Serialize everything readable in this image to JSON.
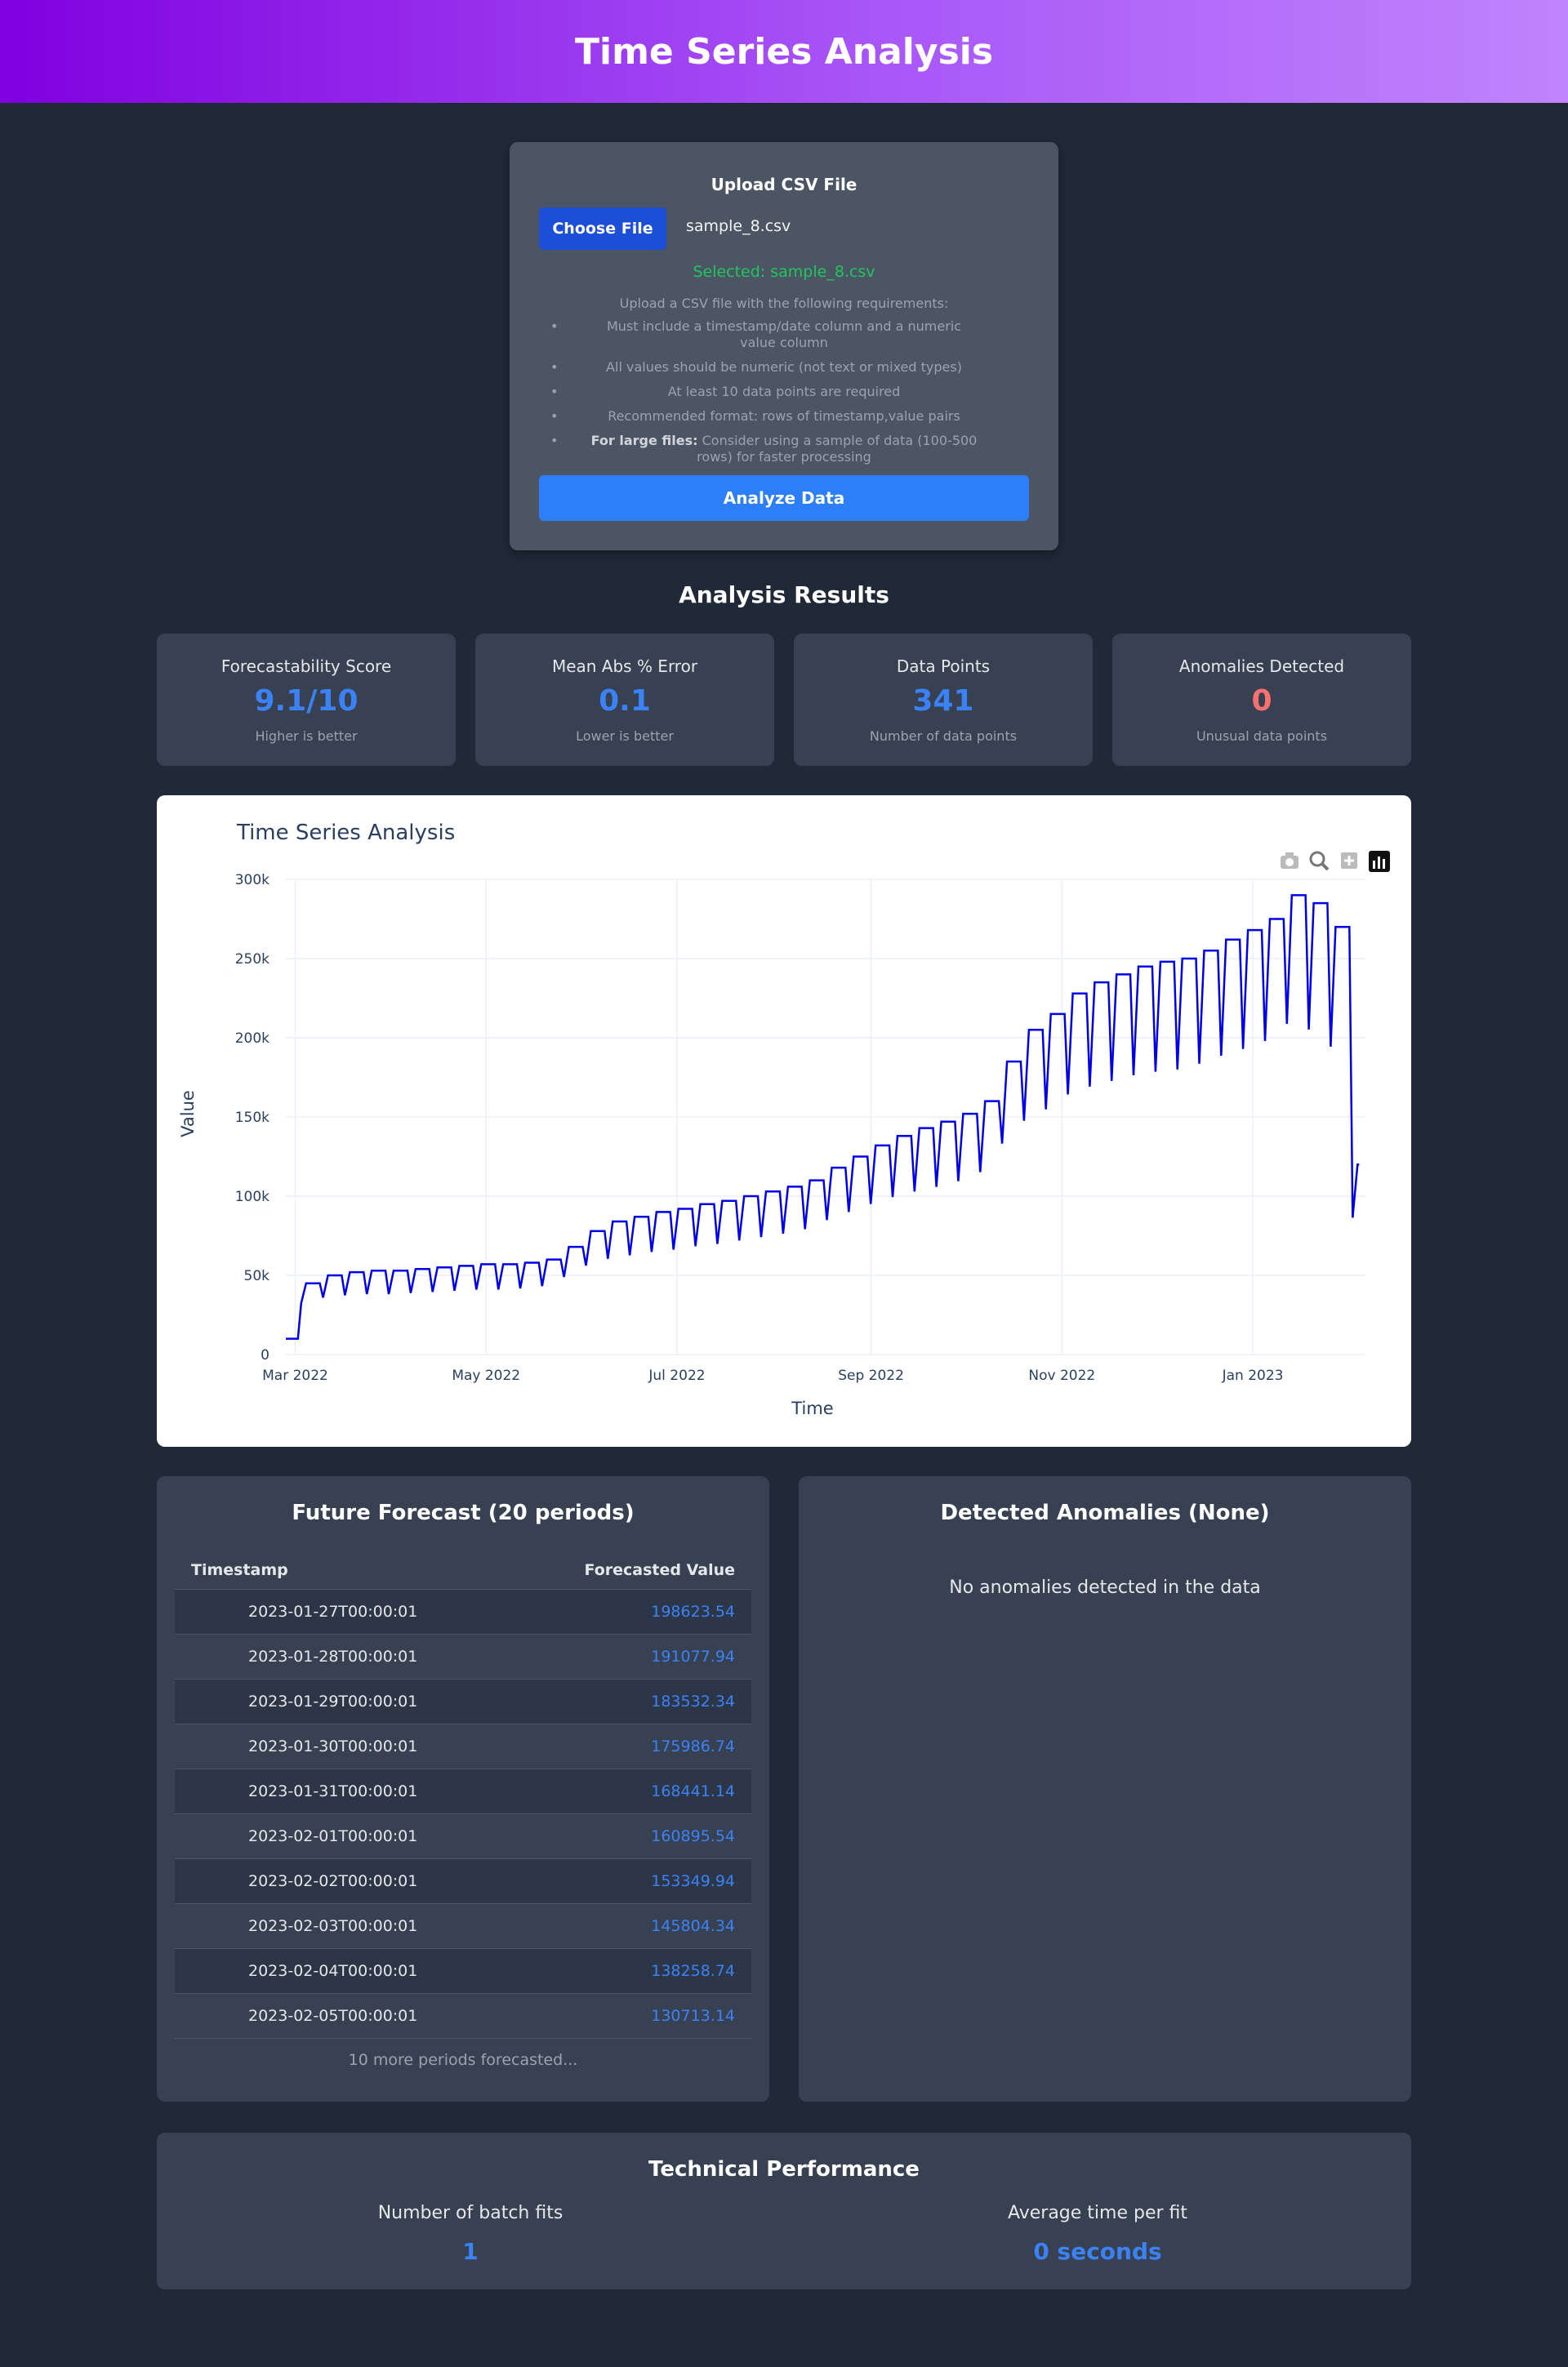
{
  "header": {
    "title": "Time Series Analysis"
  },
  "upload": {
    "title": "Upload CSV File",
    "choose_label": "Choose File",
    "file_name": "sample_8.csv",
    "selected": "Selected: sample_8.csv",
    "intro": "Upload a CSV file with the following requirements:",
    "requirements": [
      "Must include a timestamp/date column and a numeric value column",
      "All values should be numeric (not text or mixed types)",
      "At least 10 data points are required",
      "Recommended format: rows of timestamp,value pairs"
    ],
    "large_files_label": "For large files:",
    "large_files_text": "Consider using a sample of data (100-500 rows) for faster processing",
    "analyze_label": "Analyze Data"
  },
  "results": {
    "title": "Analysis Results",
    "metrics": [
      {
        "label": "Forecastability Score",
        "value": "9.1/10",
        "sub": "Higher is better"
      },
      {
        "label": "Mean Abs % Error",
        "value": "0.1",
        "sub": "Lower is better"
      },
      {
        "label": "Data Points",
        "value": "341",
        "sub": "Number of data points"
      },
      {
        "label": "Anomalies Detected",
        "value": "0",
        "sub": "Unusual data points"
      }
    ]
  },
  "chart_data": {
    "type": "line",
    "title": "Time Series Analysis",
    "xlabel": "Time",
    "ylabel": "Value",
    "x_ticks": [
      "Mar 2022",
      "May 2022",
      "Jul 2022",
      "Sep 2022",
      "Nov 2022",
      "Jan 2023"
    ],
    "y_ticks": [
      "0",
      "50k",
      "100k",
      "150k",
      "200k",
      "250k",
      "300k"
    ],
    "xlim": [
      "2022-02-26",
      "2023-02-06"
    ],
    "ylim": [
      0,
      300000
    ],
    "grid": true,
    "line_color": "#0000e6",
    "modebar_icons": [
      "camera-icon",
      "zoom-icon",
      "plus-icon",
      "bar-chart-logo-icon"
    ],
    "series": [
      {
        "x": [
          "2022-02-26",
          "2022-03-05",
          "2022-03-12",
          "2022-03-19",
          "2022-03-26",
          "2022-04-02",
          "2022-04-09",
          "2022-04-16",
          "2022-04-23",
          "2022-04-30",
          "2022-05-07",
          "2022-05-14",
          "2022-05-21",
          "2022-05-28",
          "2022-06-04",
          "2022-06-11",
          "2022-06-18",
          "2022-06-25",
          "2022-07-02",
          "2022-07-09",
          "2022-07-16",
          "2022-07-23",
          "2022-07-30",
          "2022-08-06",
          "2022-08-13",
          "2022-08-20",
          "2022-08-27",
          "2022-09-03",
          "2022-09-10",
          "2022-09-17",
          "2022-09-24",
          "2022-10-01",
          "2022-10-08",
          "2022-10-15",
          "2022-10-22",
          "2022-10-29",
          "2022-11-05",
          "2022-11-12",
          "2022-11-19",
          "2022-11-26",
          "2022-12-03",
          "2022-12-10",
          "2022-12-17",
          "2022-12-24",
          "2022-12-31",
          "2023-01-07",
          "2023-01-14",
          "2023-01-21",
          "2023-01-28",
          "2023-02-04"
        ],
        "values": [
          10000,
          45000,
          50000,
          52000,
          53000,
          53000,
          54000,
          55000,
          56000,
          57000,
          57000,
          58000,
          60000,
          68000,
          78000,
          84000,
          87000,
          90000,
          92000,
          95000,
          97000,
          100000,
          103000,
          106000,
          110000,
          118000,
          125000,
          132000,
          138000,
          143000,
          147000,
          152000,
          160000,
          185000,
          205000,
          215000,
          228000,
          235000,
          240000,
          245000,
          248000,
          250000,
          255000,
          262000,
          268000,
          275000,
          290000,
          285000,
          270000,
          120000
        ]
      }
    ]
  },
  "forecast": {
    "title": "Future Forecast (20 periods)",
    "col_timestamp": "Timestamp",
    "col_value": "Forecasted Value",
    "rows": [
      {
        "ts": "2023-01-27T00:00:01",
        "val": "198623.54"
      },
      {
        "ts": "2023-01-28T00:00:01",
        "val": "191077.94"
      },
      {
        "ts": "2023-01-29T00:00:01",
        "val": "183532.34"
      },
      {
        "ts": "2023-01-30T00:00:01",
        "val": "175986.74"
      },
      {
        "ts": "2023-01-31T00:00:01",
        "val": "168441.14"
      },
      {
        "ts": "2023-02-01T00:00:01",
        "val": "160895.54"
      },
      {
        "ts": "2023-02-02T00:00:01",
        "val": "153349.94"
      },
      {
        "ts": "2023-02-03T00:00:01",
        "val": "145804.34"
      },
      {
        "ts": "2023-02-04T00:00:01",
        "val": "138258.74"
      },
      {
        "ts": "2023-02-05T00:00:01",
        "val": "130713.14"
      }
    ],
    "more": "10 more periods forecasted..."
  },
  "anomalies": {
    "title": "Detected Anomalies (None)",
    "empty_text": "No anomalies detected in the data"
  },
  "tech": {
    "title": "Technical Performance",
    "fits_label": "Number of batch fits",
    "fits_value": "1",
    "time_label": "Average time per fit",
    "time_value": "0 seconds"
  }
}
